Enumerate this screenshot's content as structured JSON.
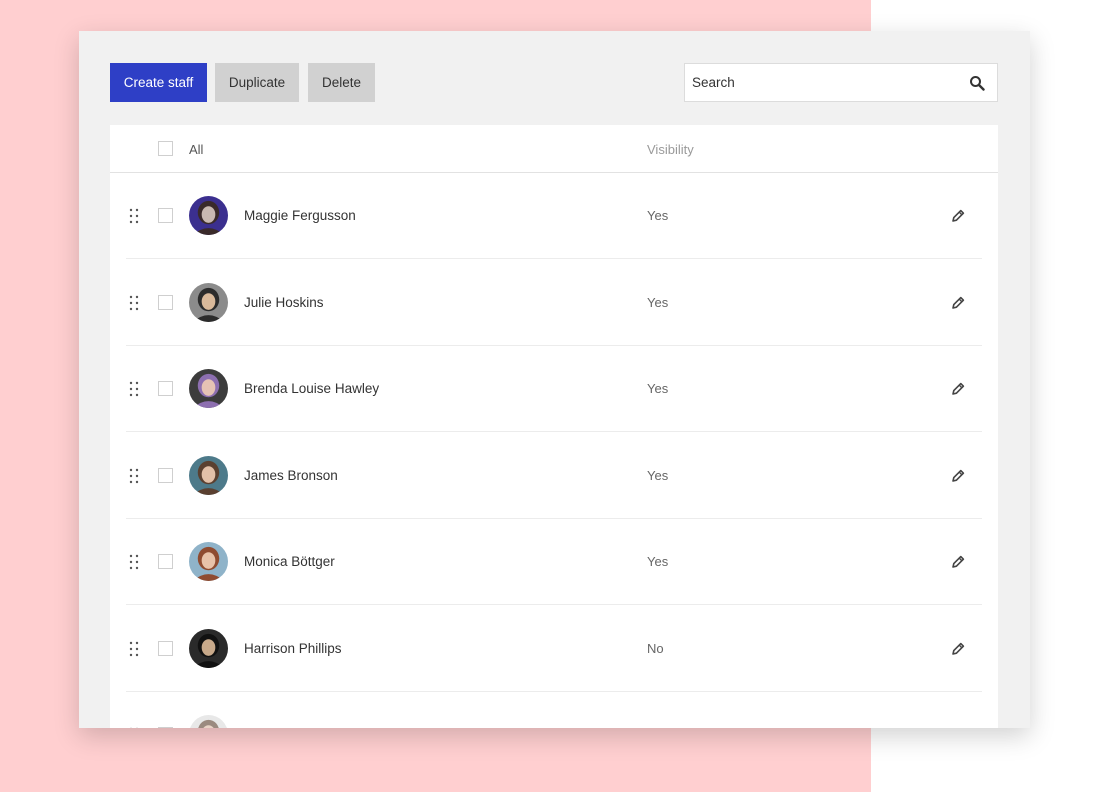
{
  "toolbar": {
    "create_label": "Create staff",
    "duplicate_label": "Duplicate",
    "delete_label": "Delete",
    "search_placeholder": "Search",
    "search_icon": "search-icon",
    "primary_color": "#2e3fc6"
  },
  "table": {
    "select_all_label": "All",
    "visibility_header": "Visibility",
    "rows": [
      {
        "name": "Maggie Fergusson",
        "visibility": "Yes",
        "avatar_colors": [
          "#3a2a2a",
          "#c9b9b2",
          "#3b2f8f"
        ]
      },
      {
        "name": "Julie Hoskins",
        "visibility": "Yes",
        "avatar_colors": [
          "#2b2b2b",
          "#d9b99a",
          "#8b8b8b"
        ]
      },
      {
        "name": "Brenda Louise Hawley",
        "visibility": "Yes",
        "avatar_colors": [
          "#8d6fb0",
          "#e6c3b4",
          "#3c3c3c"
        ]
      },
      {
        "name": "James Bronson",
        "visibility": "Yes",
        "avatar_colors": [
          "#5a4030",
          "#e2c0a8",
          "#4d7a8a"
        ]
      },
      {
        "name": "Monica Böttger",
        "visibility": "Yes",
        "avatar_colors": [
          "#8f4b30",
          "#e8c2a9",
          "#8fb3c9"
        ]
      },
      {
        "name": "Harrison Phillips",
        "visibility": "No",
        "avatar_colors": [
          "#111111",
          "#c8a98a",
          "#2a2a2a"
        ]
      },
      {
        "name": "",
        "visibility": "",
        "avatar_colors": [
          "#9b8a80",
          "#e9d3c6",
          "#e8e8e8"
        ]
      }
    ]
  }
}
